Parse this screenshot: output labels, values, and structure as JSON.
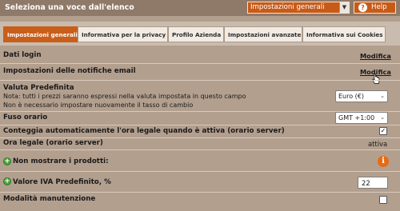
{
  "header": {
    "title": "Seleziona una voce dall'elenco",
    "select_value": "Impostazioni generali",
    "help_label": "Help"
  },
  "tabs": [
    {
      "label": "Impostazioni generali",
      "active": true
    },
    {
      "label": "Informativa per la privacy",
      "active": false
    },
    {
      "label": "Profilo Azienda",
      "active": false
    },
    {
      "label": "Impostazioni avanzate",
      "active": false
    },
    {
      "label": "Informativa sui Cookies",
      "active": false
    }
  ],
  "rows": {
    "dati_login": {
      "label": "Dati login",
      "link": "Modifica"
    },
    "notifiche": {
      "label": "Impostazioni delle notifiche email",
      "link": "Modifica"
    },
    "valuta": {
      "label": "Valuta Predefinita",
      "note1": "Nota: tutti i prezzi saranno espressi nella valuta impostata in questo campo",
      "note2": "Non è necessario impostare nuovamente il tasso di cambio",
      "value": "Euro (€)"
    },
    "fuso": {
      "label": "Fuso orario",
      "value": "GMT +1:00"
    },
    "conteggia": {
      "label": "Conteggia automaticamente l'ora legale quando è attiva (orario server)",
      "checked": true
    },
    "ora_legale": {
      "label": "Ora legale (orario server)",
      "value": "attiva"
    },
    "non_mostrare": {
      "label": "Non mostrare i prodotti:"
    },
    "iva": {
      "label": "Valore IVA Predefinito, %",
      "value": "22"
    },
    "manutenzione": {
      "label": "Modalità manutenzione",
      "checked": false
    }
  },
  "icons": {
    "help": "help-icon",
    "plus": "plus-icon",
    "info": "info-icon",
    "dropdown": "chevron-down-icon"
  },
  "colors": {
    "accent": "#c85a18",
    "header_bg": "#8f7968",
    "page_bg": "#b39f8e",
    "tabbar_bg": "#c9bcae"
  }
}
